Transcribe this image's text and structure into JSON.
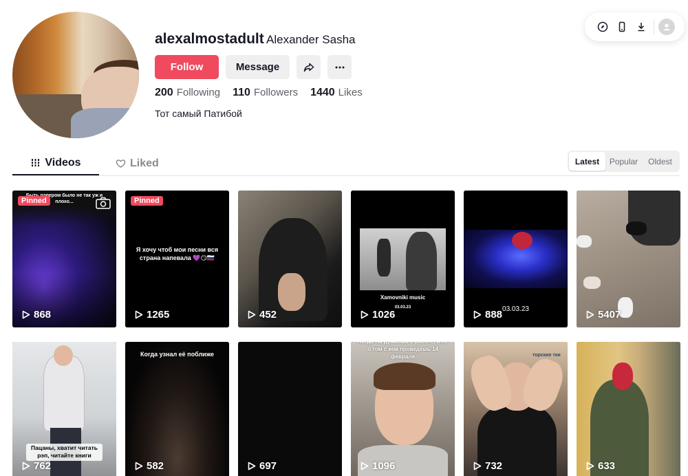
{
  "profile": {
    "username": "alexalmostadult",
    "nickname": "Alexander Sasha",
    "follow_label": "Follow",
    "message_label": "Message",
    "bio": "Тот самый Патибой",
    "stats": [
      {
        "value": "200",
        "label": "Following"
      },
      {
        "value": "110",
        "label": "Followers"
      },
      {
        "value": "1440",
        "label": "Likes"
      }
    ]
  },
  "tabs": {
    "videos": "Videos",
    "liked": "Liked"
  },
  "sort": {
    "latest": "Latest",
    "popular": "Popular",
    "oldest": "Oldest",
    "selected": "Latest"
  },
  "colors": {
    "accent": "#ef4a5e",
    "text": "#161823",
    "muted": "#8a8b91"
  },
  "videos": [
    {
      "views": "868",
      "pinned": "Pinned",
      "caption": "Быть рэпером было не так уж и плохо..."
    },
    {
      "views": "1265",
      "pinned": "Pinned",
      "caption": "Я хочу чтоб мои песни вся страна напевала 💜😏🇷🇺"
    },
    {
      "views": "452"
    },
    {
      "views": "1026",
      "caption": "Xamovniki music",
      "subcaption": "03.03.23"
    },
    {
      "views": "888",
      "caption": "03.03.23"
    },
    {
      "views": "5407"
    },
    {
      "views": "762",
      "caption": "Пацаны, хватит читать рэп, читайте книги"
    },
    {
      "views": "582",
      "caption": "Когда узнал её поближе"
    },
    {
      "views": "697"
    },
    {
      "views": "1096",
      "caption": "Когда ты думаешь о работе, а не о том с кем проведёшь 14 февраля"
    },
    {
      "views": "732",
      "caption": "торские тки"
    },
    {
      "views": "633"
    }
  ]
}
